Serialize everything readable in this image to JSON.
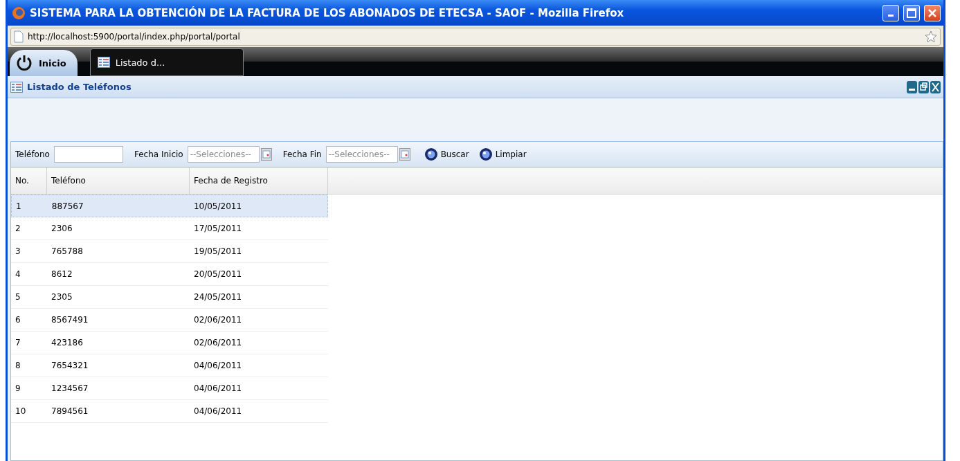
{
  "window": {
    "title": "SISTEMA PARA LA OBTENCIÓN DE LA FACTURA DE LOS ABONADOS DE ETECSA - SAOF - Mozilla Firefox"
  },
  "address_bar": {
    "url": "http://localhost:5900/portal/index.php/portal/portal"
  },
  "taskbar": {
    "start_label": "Inicio",
    "tabs": [
      {
        "label": "Listado d...",
        "selected": true
      }
    ]
  },
  "panel": {
    "title": "Listado de Teléfonos"
  },
  "filters": [
    {
      "kind": "text",
      "label": "Teléfono"
    },
    {
      "kind": "date",
      "label": "Fecha Inicio",
      "placeholder": "--Selecciones--"
    },
    {
      "kind": "date",
      "label": "Fecha Fin",
      "placeholder": "--Selecciones--"
    }
  ],
  "buttons": [
    "Buscar",
    "Limpiar"
  ],
  "table": {
    "columns": [
      "No.",
      "Teléfono",
      "Fecha de Registro"
    ],
    "rows": [
      {
        "cells": [
          "1",
          "887567",
          "10/05/2011"
        ],
        "selected": true
      },
      {
        "cells": [
          "2",
          "2306",
          "17/05/2011"
        ],
        "selected": false
      },
      {
        "cells": [
          "3",
          "765788",
          "19/05/2011"
        ],
        "selected": false
      },
      {
        "cells": [
          "4",
          "8612",
          "20/05/2011"
        ],
        "selected": false
      },
      {
        "cells": [
          "5",
          "2305",
          "24/05/2011"
        ],
        "selected": false
      },
      {
        "cells": [
          "6",
          "8567491",
          "02/06/2011"
        ],
        "selected": false
      },
      {
        "cells": [
          "7",
          "423186",
          "02/06/2011"
        ],
        "selected": false
      },
      {
        "cells": [
          "8",
          "7654321",
          "04/06/2011"
        ],
        "selected": false
      },
      {
        "cells": [
          "9",
          "1234567",
          "04/06/2011"
        ],
        "selected": false
      },
      {
        "cells": [
          "10",
          "7894561",
          "04/06/2011"
        ],
        "selected": false
      }
    ]
  }
}
